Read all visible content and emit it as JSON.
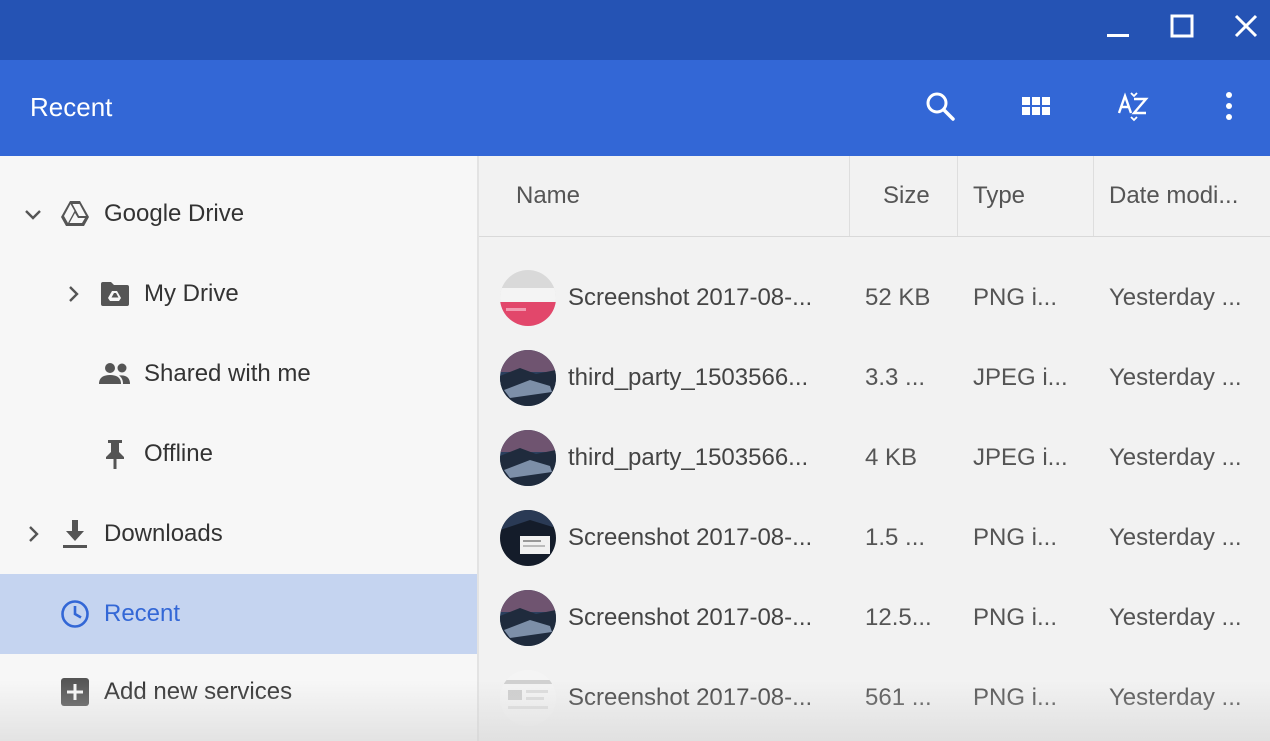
{
  "window": {
    "minimize_icon": "minimize-icon",
    "maximize_icon": "maximize-icon",
    "close_icon": "close-icon"
  },
  "header": {
    "title": "Recent",
    "tools": [
      "search-icon",
      "grid-view-icon",
      "sort-az-icon",
      "more-vert-icon"
    ]
  },
  "sidebar": {
    "items": [
      {
        "label": "Google Drive",
        "icon": "drive-icon",
        "expander": "chevron-down"
      },
      {
        "label": "My Drive",
        "icon": "drive-folder-icon",
        "expander": "chevron-right"
      },
      {
        "label": "Shared with me",
        "icon": "people-icon"
      },
      {
        "label": "Offline",
        "icon": "pin-icon"
      },
      {
        "label": "Downloads",
        "icon": "download-icon",
        "expander": "chevron-right"
      },
      {
        "label": "Recent",
        "icon": "clock-icon",
        "active": true
      },
      {
        "label": "Add new services",
        "icon": "plus-box-icon"
      }
    ]
  },
  "table": {
    "columns": [
      "Name",
      "Size",
      "Type",
      "Date modi..."
    ],
    "rows": [
      {
        "name": "Screenshot 2017-08-...",
        "size": "52 KB",
        "type": "PNG i...",
        "date": "Yesterday ..."
      },
      {
        "name": "third_party_1503566...",
        "size": "3.3 ...",
        "type": "JPEG i...",
        "date": "Yesterday ..."
      },
      {
        "name": "third_party_1503566...",
        "size": "4 KB",
        "type": "JPEG i...",
        "date": "Yesterday ..."
      },
      {
        "name": "Screenshot 2017-08-...",
        "size": "1.5 ...",
        "type": "PNG i...",
        "date": "Yesterday ..."
      },
      {
        "name": "Screenshot 2017-08-...",
        "size": "12.5...",
        "type": "PNG i...",
        "date": "Yesterday ..."
      },
      {
        "name": "Screenshot 2017-08-...",
        "size": "561 ...",
        "type": "PNG i...",
        "date": "Yesterday ..."
      }
    ]
  },
  "colors": {
    "titlebar": "#2553b4",
    "appbar": "#3367d6",
    "active_nav": "#c5d4f0",
    "accent": "#3367d6"
  }
}
